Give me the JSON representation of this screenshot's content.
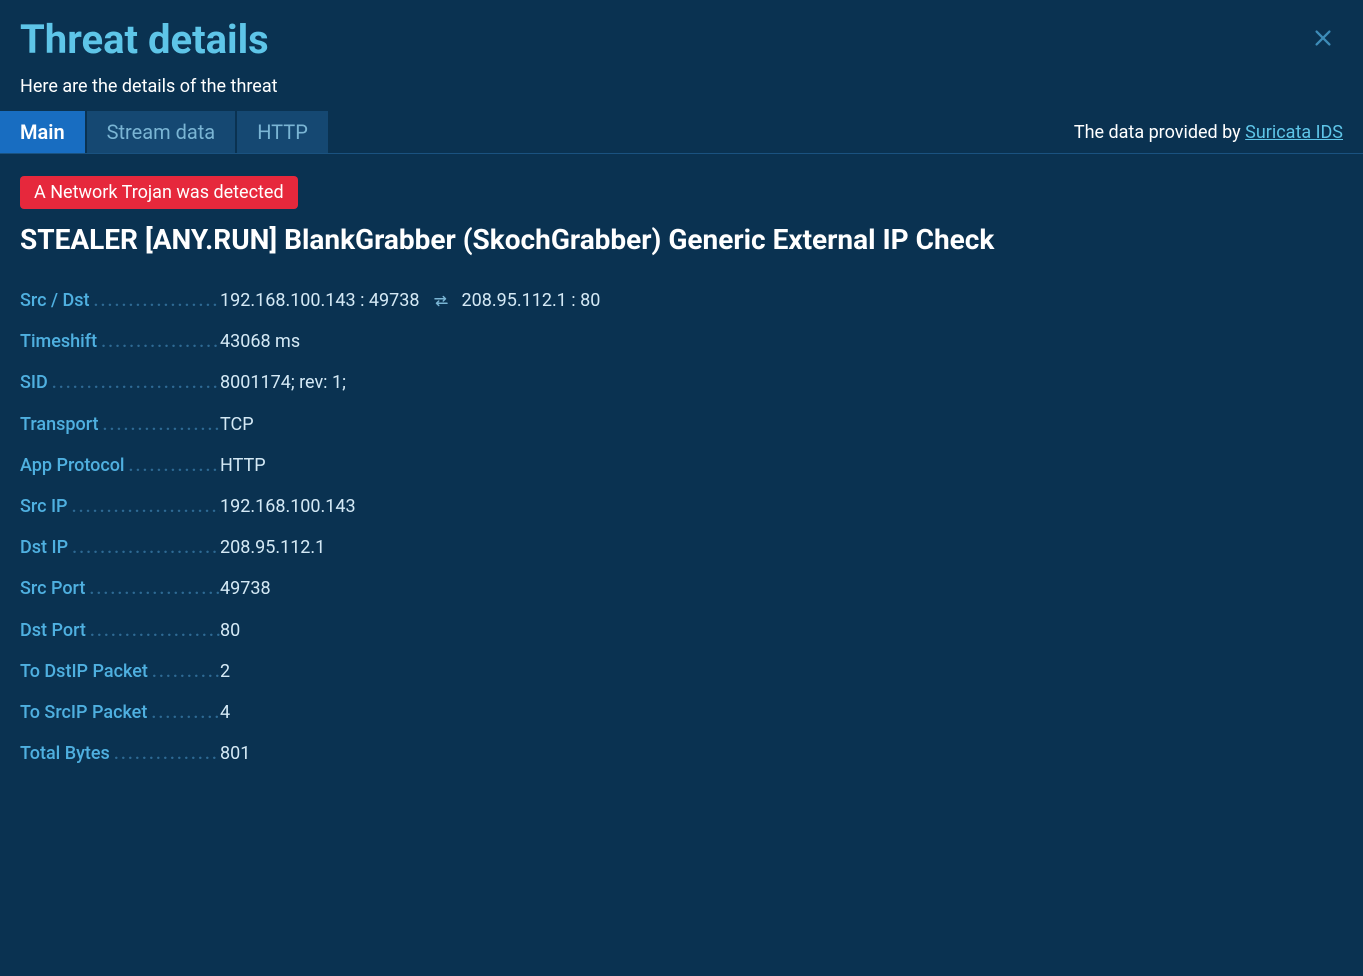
{
  "header": {
    "title": "Threat details",
    "subtitle": "Here are the details of the threat"
  },
  "tabs": {
    "items": [
      {
        "label": "Main",
        "active": true
      },
      {
        "label": "Stream data",
        "active": false
      },
      {
        "label": "HTTP",
        "active": false
      }
    ]
  },
  "provider": {
    "prefix": "The data provided by ",
    "link_text": "Suricata IDS"
  },
  "threat": {
    "badge": "A Network Trojan was detected",
    "name": "STEALER [ANY.RUN] BlankGrabber (SkochGrabber) Generic External IP Check"
  },
  "details": {
    "src_dst_label": "Src / Dst",
    "src_dst_left": "192.168.100.143 : 49738",
    "src_dst_right": "208.95.112.1 : 80",
    "rows": [
      {
        "label": "Timeshift",
        "value": "43068 ms"
      },
      {
        "label": "SID",
        "value": "8001174; rev: 1;"
      },
      {
        "label": "Transport",
        "value": "TCP"
      },
      {
        "label": "App Protocol",
        "value": "HTTP"
      },
      {
        "label": "Src IP",
        "value": "192.168.100.143"
      },
      {
        "label": "Dst IP",
        "value": "208.95.112.1"
      },
      {
        "label": "Src Port",
        "value": "49738"
      },
      {
        "label": "Dst Port",
        "value": "80"
      },
      {
        "label": "To DstIP Packet",
        "value": "2"
      },
      {
        "label": "To SrcIP Packet",
        "value": "4"
      },
      {
        "label": "Total Bytes",
        "value": "801"
      }
    ]
  }
}
